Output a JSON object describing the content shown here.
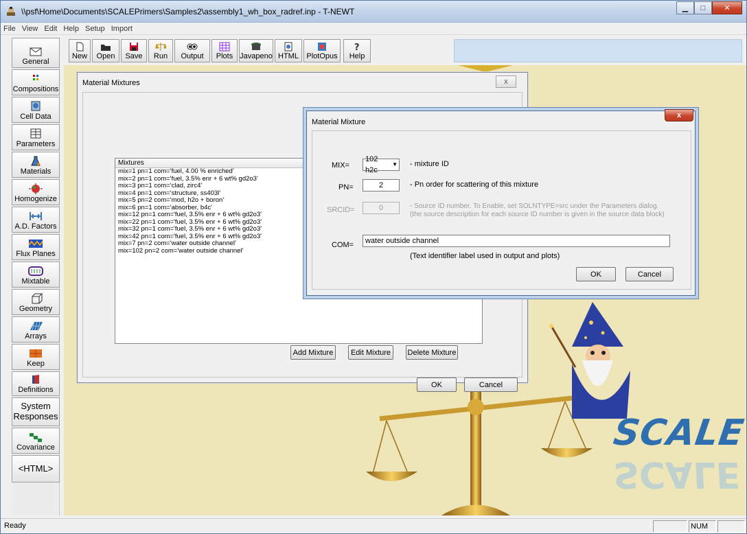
{
  "window": {
    "title": "\\\\psf\\Home\\Documents\\SCALEPrimers\\Samples2\\assembly1_wh_box_radref.inp - T-NEWT"
  },
  "menu": [
    "File",
    "View",
    "Edit",
    "Help",
    "Setup",
    "Import"
  ],
  "toolbar": [
    {
      "label": "New",
      "icon": "new-document-icon"
    },
    {
      "label": "Open",
      "icon": "folder-icon"
    },
    {
      "label": "Save",
      "icon": "floppy-icon"
    },
    {
      "label": "Run",
      "icon": "balance-scale-icon"
    },
    {
      "label": "Output",
      "icon": "eyes-icon"
    },
    {
      "label": "Plots",
      "icon": "grid-plot-icon"
    },
    {
      "label": "Javapeno",
      "icon": "pot-icon"
    },
    {
      "label": "HTML",
      "icon": "web-page-icon"
    },
    {
      "label": "PlotOpus",
      "icon": "plot-opus-icon"
    },
    {
      "label": "Help",
      "icon": "question-icon"
    }
  ],
  "sidebar": [
    {
      "label": "General",
      "icon": "envelope-icon"
    },
    {
      "label": "Compositions",
      "icon": "dots-icon"
    },
    {
      "label": "Cell Data",
      "icon": "cell-icon"
    },
    {
      "label": "Parameters",
      "icon": "table-icon"
    },
    {
      "label": "Materials",
      "icon": "flask-icon"
    },
    {
      "label": "Homogenize",
      "icon": "globe-arrows-icon"
    },
    {
      "label": "A.D. Factors",
      "icon": "factors-icon"
    },
    {
      "label": "Flux Planes",
      "icon": "flux-icon"
    },
    {
      "label": "Mixtable",
      "icon": "mixtable-icon"
    },
    {
      "label": "Geometry",
      "icon": "cube-icon"
    },
    {
      "label": "Arrays",
      "icon": "arrays-icon"
    },
    {
      "label": "Keep",
      "icon": "keep-icon"
    },
    {
      "label": "Definitions",
      "icon": "book-icon"
    },
    {
      "label": "System\nResponses",
      "icon": ""
    },
    {
      "label": "Covariance",
      "icon": "covariance-icon"
    },
    {
      "label": "<HTML>",
      "icon": ""
    }
  ],
  "mixtures_dialog": {
    "title": "Material Mixtures",
    "list_header": "Mixtures",
    "rows": [
      "mix=1 pn=1 com='fuel, 4.00 % enriched'",
      "mix=2 pn=1 com='fuel, 3.5% enr + 6 wt% gd2o3'",
      "mix=3 pn=1 com='clad, zirc4'",
      "mix=4 pn=1 com='structure, ss403l'",
      "mix=5 pn=2 com='mod, h2o + boron'",
      "mix=6 pn=1 com='absorber, b4c'",
      "mix=12 pn=1 com='fuel, 3.5% enr + 6 wt% gd2o3'",
      "mix=22 pn=1 com='fuel, 3.5% enr + 6 wt% gd2o3'",
      "mix=32 pn=1 com='fuel, 3.5% enr + 6 wt% gd2o3'",
      "mix=42 pn=1 com='fuel, 3.5% enr + 6 wt% gd2o3'",
      "mix=7 pn=2 com='water outside channel'",
      "mix=102 pn=2 com='water outside channel'"
    ],
    "buttons": {
      "add": "Add Mixture",
      "edit": "Edit Mixture",
      "delete": "Delete Mixture",
      "ok": "OK",
      "cancel": "Cancel"
    },
    "close_glyph": "x"
  },
  "mixture_dialog": {
    "title": "Material Mixture",
    "close_glyph": "x",
    "mix_label": "MIX=",
    "mix_value": "102 h2c",
    "mix_desc": "- mixture ID",
    "pn_label": "PN=",
    "pn_value": "2",
    "pn_desc": "- Pn order for scattering of this mixture",
    "srcid_label": "SRCID=",
    "srcid_value": "0",
    "srcid_desc1": "- Source ID number. To Enable, set SOLNTYPE=src under the Parameters dialog.",
    "srcid_desc2": "(the source description for each source ID number is given in the source data block)",
    "com_label": "COM=",
    "com_value": "water outside channel",
    "com_desc": "(Text identifier label used in output and plots)",
    "ok": "OK",
    "cancel": "Cancel"
  },
  "logo_text": "SCALE",
  "status": {
    "ready": "Ready",
    "num": "NUM"
  },
  "colors": {
    "accent": "#2f6fb0",
    "close": "#c8462c"
  }
}
